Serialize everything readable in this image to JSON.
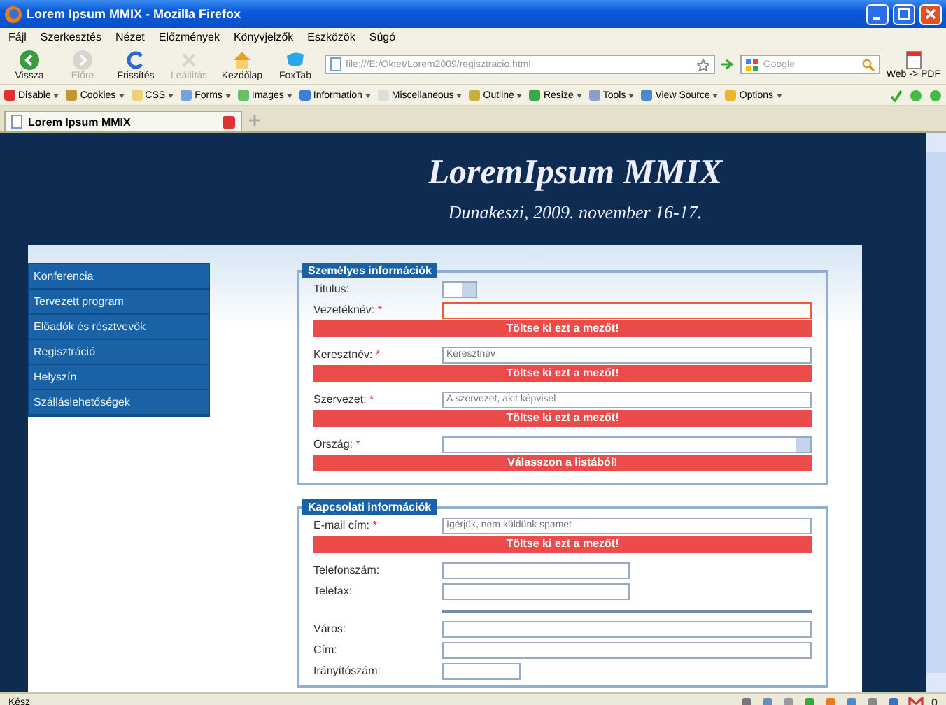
{
  "window": {
    "title": "Lorem Ipsum MMIX - Mozilla Firefox"
  },
  "menu": [
    "Fájl",
    "Szerkesztés",
    "Nézet",
    "Előzmények",
    "Könyvjelzők",
    "Eszközök",
    "Súgó"
  ],
  "nav_buttons": [
    {
      "label": "Vissza",
      "kind": "back",
      "disabled": false
    },
    {
      "label": "Előre",
      "kind": "forward",
      "disabled": true
    },
    {
      "label": "Frissítés",
      "kind": "reload",
      "disabled": false
    },
    {
      "label": "Leállítás",
      "kind": "stop",
      "disabled": true
    },
    {
      "label": "Kezdőlap",
      "kind": "home",
      "disabled": false
    },
    {
      "label": "FoxTab",
      "kind": "foxtab",
      "disabled": false
    }
  ],
  "address_bar": {
    "url": "file:///E:/Oktet/Lorem2009/regisztracio.html"
  },
  "search": {
    "placeholder": "Google"
  },
  "pdf_button": {
    "label": "Web -> PDF"
  },
  "dev_toolbar": [
    "Disable",
    "Cookies",
    "CSS",
    "Forms",
    "Images",
    "Information",
    "Miscellaneous",
    "Outline",
    "Resize",
    "Tools",
    "View Source",
    "Options"
  ],
  "tabs": [
    {
      "label": "Lorem Ipsum MMIX",
      "selected": true
    }
  ],
  "page": {
    "title": "LoremIpsum MMIX",
    "subtitle": "Dunakeszi, 2009. november 16-17.",
    "sidebar": {
      "items": [
        "Konferencia",
        "Tervezett program",
        "Előadók és résztvevők",
        "Regisztráció",
        "Helyszín",
        "Szálláslehetőségek"
      ]
    },
    "fieldsets": [
      {
        "legend": "Személyes információk",
        "fields": [
          {
            "kind": "dropdown-small",
            "label": "Titulus:"
          },
          {
            "kind": "text",
            "label": "Vezetéknév:",
            "mark": "*",
            "highlighted": true,
            "error": "Töltse ki ezt a mezőt!"
          },
          {
            "kind": "text",
            "label": "Keresztnév:",
            "mark": "*",
            "placeholder": "Keresztnév",
            "highlighted": false,
            "error": "Töltse ki ezt a mezőt!"
          },
          {
            "kind": "text",
            "label": "Szervezet:",
            "mark": "*",
            "placeholder": "A szervezet, akit képvisel",
            "highlighted": false,
            "error": "Töltse ki ezt a mezőt!"
          },
          {
            "kind": "dropdown",
            "label": "Ország:",
            "mark": "*",
            "error": "Válasszon a listából!"
          }
        ]
      },
      {
        "legend": "Kapcsolati információk",
        "fields": [
          {
            "kind": "text",
            "label": "E-mail cím:",
            "mark": "*",
            "placeholder": "Igérjük, nem küldünk spamet",
            "highlighted": false,
            "error": "Töltse ki ezt a mezőt!"
          },
          {
            "kind": "text-short",
            "label": "Telefonszám:",
            "highlighted": false
          },
          {
            "kind": "text-short",
            "label": "Telefax:",
            "highlighted": false
          },
          {
            "kind": "divider"
          },
          {
            "kind": "text",
            "label": "Város:",
            "highlighted": false
          },
          {
            "kind": "text",
            "label": "Cím:",
            "highlighted": false
          },
          {
            "kind": "text-tiny",
            "label": "Irányítószám:",
            "highlighted": false
          }
        ]
      }
    ]
  },
  "status_bar": {
    "text": "Kész",
    "mail_count": "0"
  }
}
